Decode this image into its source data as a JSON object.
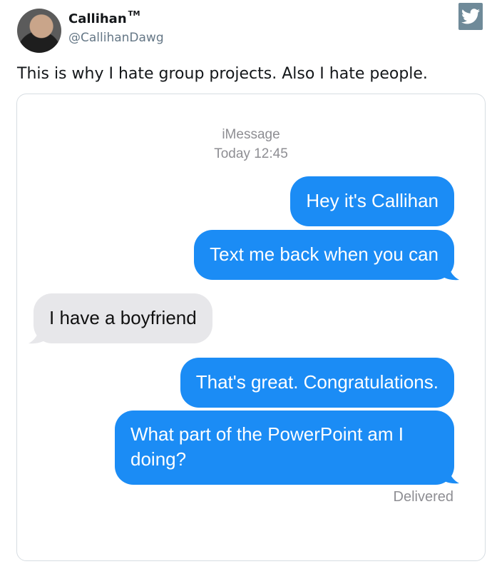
{
  "tweet": {
    "display_name": "Callihan",
    "trademark": "TM",
    "handle": "@CallihanDawg",
    "text": "This is why I hate group projects. Also I hate people.",
    "twitter_icon": "twitter-bird-icon"
  },
  "conversation": {
    "service": "iMessage",
    "timestamp": "Today 12:45",
    "messages": [
      {
        "direction": "outgoing",
        "text": "Hey it's Callihan"
      },
      {
        "direction": "outgoing",
        "text": "Text me back when you can"
      },
      {
        "direction": "incoming",
        "text": "I have a boyfriend"
      },
      {
        "direction": "outgoing",
        "text": "That's great. Congratulations."
      },
      {
        "direction": "outgoing",
        "text": "What part of the PowerPoint am I doing?"
      }
    ],
    "status": "Delivered"
  },
  "colors": {
    "outgoing_bubble": "#1b8cf5",
    "incoming_bubble": "#e7e7ea",
    "meta_text": "#8e8e93",
    "handle_text": "#657786"
  }
}
